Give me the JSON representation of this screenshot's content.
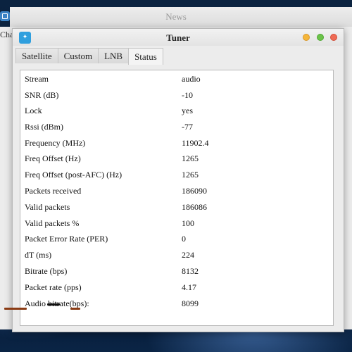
{
  "back_window": {
    "title": "News",
    "partial_tab": "Chat"
  },
  "tuner": {
    "title": "Tuner",
    "app_icon_glyph": "✦",
    "tabs": [
      {
        "label": "Satellite",
        "active": false
      },
      {
        "label": "Custom",
        "active": false
      },
      {
        "label": "LNB",
        "active": false
      },
      {
        "label": "Status",
        "active": true
      }
    ],
    "status_rows": [
      {
        "key": "Stream",
        "value": "audio"
      },
      {
        "key": "SNR (dB)",
        "value": "-10"
      },
      {
        "key": "Lock",
        "value": "yes"
      },
      {
        "key": "Rssi (dBm)",
        "value": "-77"
      },
      {
        "key": "Frequency (MHz)",
        "value": "11902.4"
      },
      {
        "key": "Freq Offset (Hz)",
        "value": "1265"
      },
      {
        "key": "Freq Offset (post-AFC) (Hz)",
        "value": "1265"
      },
      {
        "key": "Packets received",
        "value": "186090"
      },
      {
        "key": "Valid packets",
        "value": "186086"
      },
      {
        "key": "Valid packets %",
        "value": "100"
      },
      {
        "key": "Packet Error Rate (PER)",
        "value": "0"
      },
      {
        "key": "dT (ms)",
        "value": "224"
      },
      {
        "key": "Bitrate (bps)",
        "value": "8132"
      },
      {
        "key": "Packet rate (pps)",
        "value": "4.17"
      },
      {
        "key": "Audio bitrate(bps):",
        "value": "8099"
      }
    ]
  },
  "colors": {
    "close": "#ef6b55",
    "minimize": "#f5b63a",
    "maximize": "#6cc34a",
    "app_icon": "#2f9fde"
  }
}
